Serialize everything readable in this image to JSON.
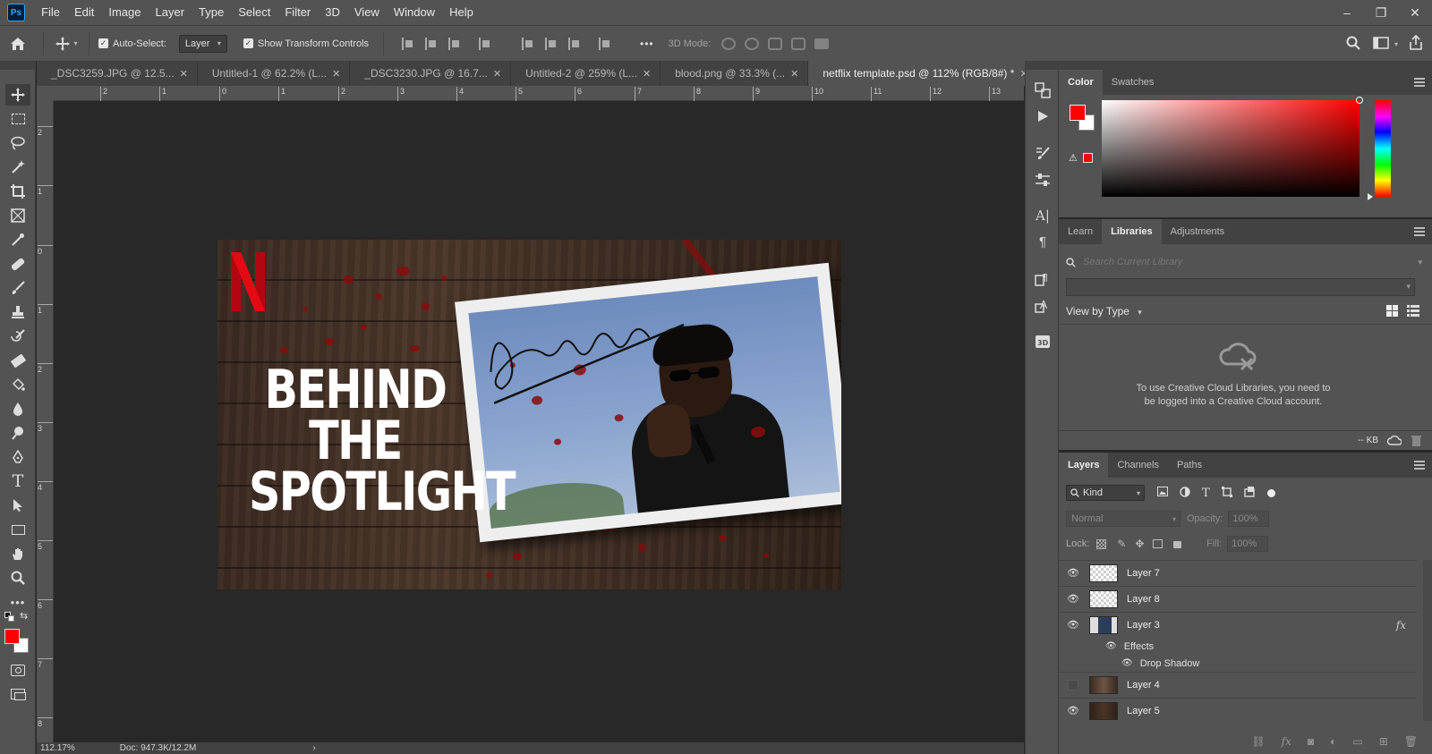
{
  "app": {
    "logo": "Ps"
  },
  "menu": [
    "File",
    "Edit",
    "Image",
    "Layer",
    "Type",
    "Select",
    "Filter",
    "3D",
    "View",
    "Window",
    "Help"
  ],
  "window_controls": {
    "minimize": "–",
    "restore": "❐",
    "close": "✕"
  },
  "options_bar": {
    "auto_select_label": "Auto-Select:",
    "auto_select_value": "Layer",
    "show_transform_label": "Show Transform Controls",
    "more": "•••",
    "mode_label": "3D Mode:"
  },
  "tabs": [
    {
      "label": "_DSC3259.JPG @ 12.5...",
      "close": "✕",
      "active": false
    },
    {
      "label": "Untitled-1 @ 62.2% (L...",
      "close": "✕",
      "active": false
    },
    {
      "label": "_DSC3230.JPG @ 16.7...",
      "close": "✕",
      "active": false
    },
    {
      "label": "Untitled-2 @ 259% (L...",
      "close": "✕",
      "active": false
    },
    {
      "label": "blood.png @ 33.3% (...",
      "close": "✕",
      "active": false
    },
    {
      "label": "netflix template.psd @ 112% (RGB/8#) *",
      "close": "✕",
      "active": true
    }
  ],
  "ruler_top": [
    "2",
    "1",
    "0",
    "1",
    "2",
    "3",
    "4",
    "5",
    "6",
    "7",
    "8",
    "9",
    "10",
    "11",
    "12",
    "13"
  ],
  "ruler_left": [
    "2",
    "1",
    "0",
    "1",
    "2",
    "3",
    "4",
    "5",
    "6",
    "7",
    "8"
  ],
  "document": {
    "logo_letter": "N",
    "title_lines": [
      "BEHIND",
      "THE",
      "SPOTLIGHT"
    ],
    "signature": "2Ceewho"
  },
  "color_panel": {
    "tabs": [
      "Color",
      "Swatches"
    ],
    "foreground": "#ff0000",
    "background": "#ffffff",
    "warning": "⚠"
  },
  "libraries_panel": {
    "tabs": [
      "Learn",
      "Libraries",
      "Adjustments"
    ],
    "search_placeholder": "Search Current Library",
    "view_by": "View by Type",
    "message": "To use Creative Cloud Libraries, you need to be logged into a Creative Cloud account.",
    "size": "-- KB"
  },
  "layers_panel": {
    "tabs": [
      "Layers",
      "Channels",
      "Paths"
    ],
    "kind": "Kind",
    "blend_mode": "Normal",
    "opacity_label": "Opacity:",
    "opacity_value": "100%",
    "lock_label": "Lock:",
    "fill_label": "Fill:",
    "fill_value": "100%",
    "layers": [
      {
        "name": "Layer 7",
        "visible": true,
        "fx": ""
      },
      {
        "name": "Layer 8",
        "visible": true,
        "fx": ""
      },
      {
        "name": "Layer 3",
        "visible": true,
        "fx": "fx"
      },
      {
        "name": "Layer 4",
        "visible": false,
        "fx": ""
      },
      {
        "name": "Layer 5",
        "visible": true,
        "fx": ""
      }
    ],
    "effects_label": "Effects",
    "effect_item": "Drop Shadow"
  },
  "status_bar": {
    "zoom": "112.17%",
    "doc": "Doc: 947.3K/12.2M",
    "arrow": "›"
  },
  "colors": {
    "accent": "#31a8ff",
    "netflix_red": "#e50914"
  }
}
